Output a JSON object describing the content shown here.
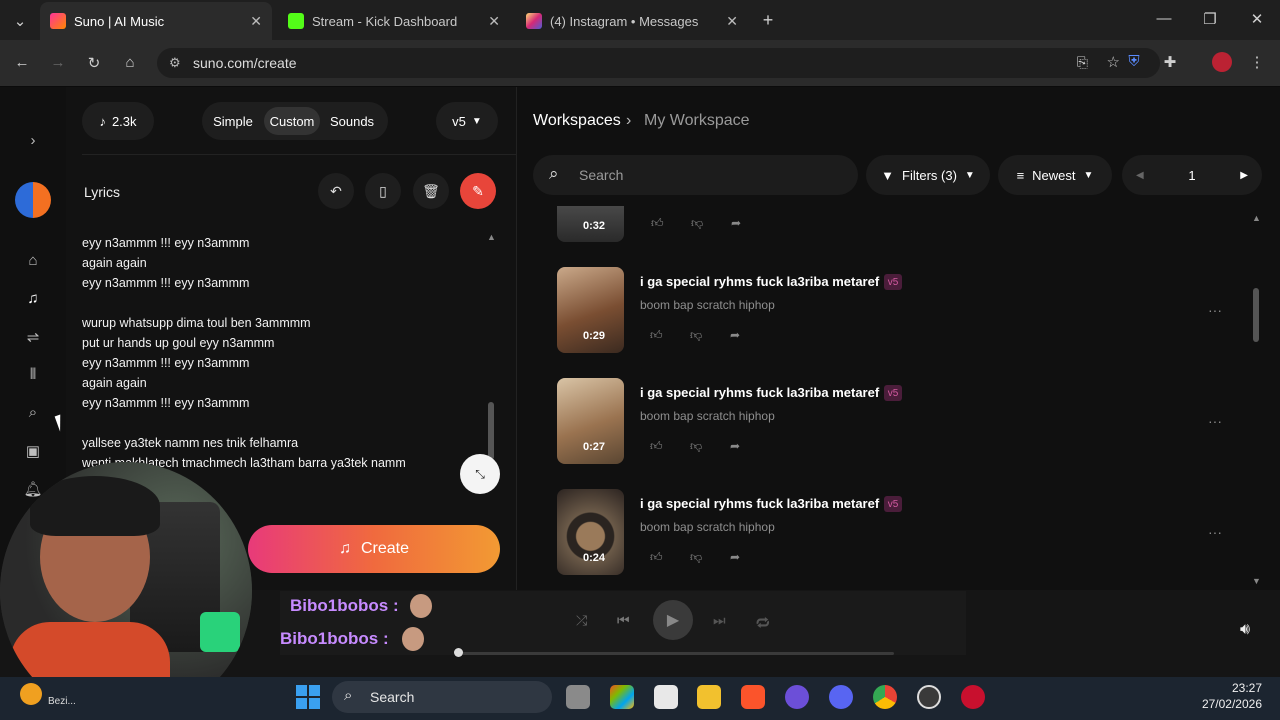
{
  "browser": {
    "tabs": [
      {
        "title": "Suno | AI Music",
        "active": true
      },
      {
        "title": "Stream - Kick Dashboard",
        "active": false
      },
      {
        "title": "(4) Instagram • Messages",
        "active": false
      }
    ],
    "url": "suno.com/create"
  },
  "app": {
    "credits": "2.3k",
    "modes": [
      "Simple",
      "Custom",
      "Sounds"
    ],
    "selected_mode": "Custom",
    "version": "v5",
    "lyrics_label": "Lyrics",
    "lyrics_lines": [
      "eyy n3ammm  !!! eyy n3ammm",
      "again again",
      "eyy n3ammm  !!! eyy n3ammm",
      "",
      "wurup whatsupp dima toul ben 3ammmm",
      "put ur hands up goul eyy n3ammm",
      "eyy n3ammm  !!! eyy n3ammm",
      "again again",
      "eyy n3ammm  !!! eyy n3ammm",
      "",
      "yallsee ya3tek namm nes tnik felhamra",
      "wenti makhlatech tmachmech la3tham barra ya3tek namm"
    ],
    "create_label": "Create",
    "breadcrumb": {
      "root": "Workspaces",
      "current": "My Workspace"
    },
    "search_placeholder": "Search",
    "filters_label": "Filters (3)",
    "sort_label": "Newest",
    "page_number": "1",
    "songs": [
      {
        "title": "",
        "style": "",
        "duration": "0:32",
        "badge": ""
      },
      {
        "title": "i ga special ryhms fuck la3riba metaref",
        "style": "boom bap scratch hiphop",
        "duration": "0:29",
        "badge": "v5"
      },
      {
        "title": "i ga special ryhms fuck la3riba metaref",
        "style": "boom bap scratch hiphop",
        "duration": "0:27",
        "badge": "v5"
      },
      {
        "title": "i ga special ryhms fuck la3riba metaref",
        "style": "boom bap scratch hiphop",
        "duration": "0:24",
        "badge": "v5"
      }
    ]
  },
  "overlay": {
    "chat_users": [
      "Bibo1bobos :",
      "Bibo1bobos :"
    ]
  },
  "taskbar": {
    "search_label": "Search",
    "time": "23:27",
    "date": "27/02/2026",
    "weather_text": "Bezi..."
  },
  "colors": {
    "accent_gradient_start": "#e83a7a",
    "accent_gradient_end": "#f29a33",
    "badge_bg": "#4a1d3a",
    "chat_name": "#c78bff"
  }
}
